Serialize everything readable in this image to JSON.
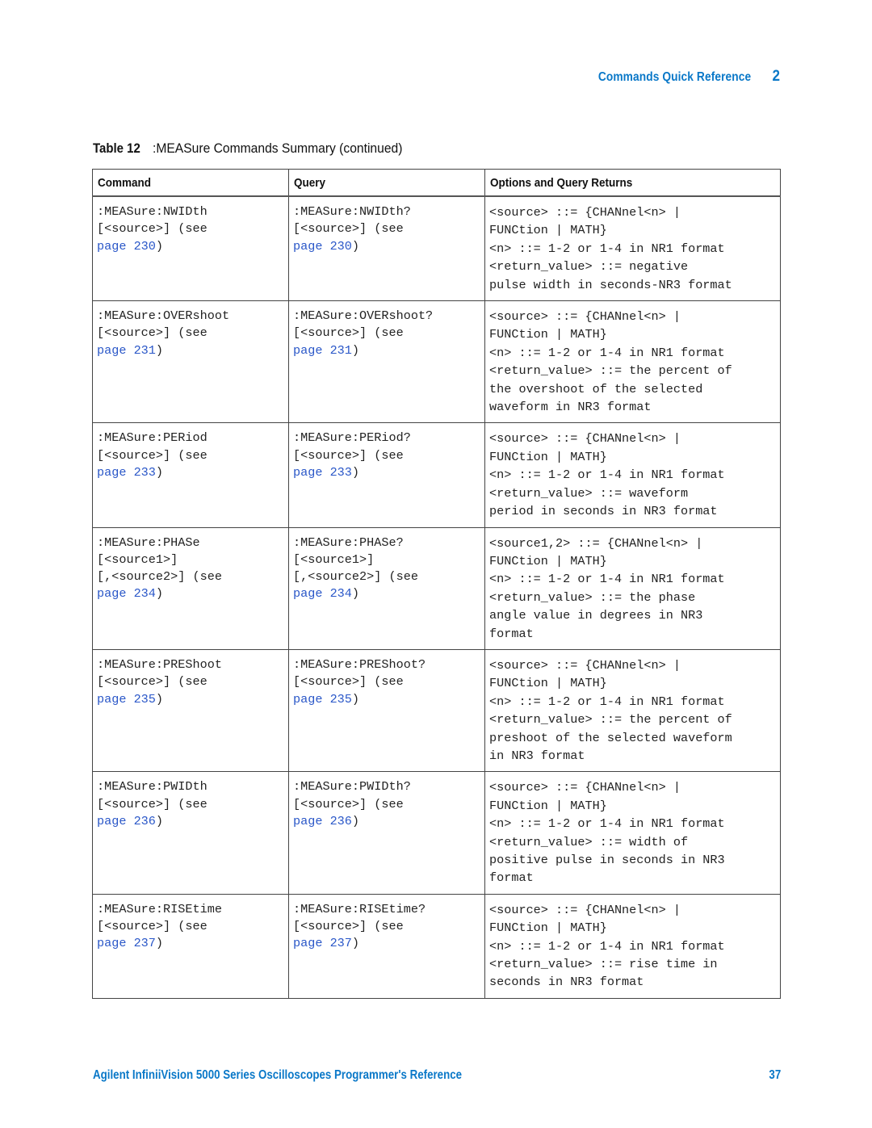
{
  "header": {
    "section_title": "Commands Quick Reference",
    "chapter_number": "2"
  },
  "table": {
    "label": "Table 12",
    "title": ":MEASure Commands Summary (continued)",
    "columns": [
      "Command",
      "Query",
      "Options and Query Returns"
    ],
    "rows": [
      {
        "command": [
          ":MEASure:NWIDth",
          "[<source>] (see"
        ],
        "command_link": "page 230",
        "query": [
          ":MEASure:NWIDth?",
          "[<source>] (see"
        ],
        "query_link": "page 230",
        "options": [
          "<source> ::= {CHANnel<n> |",
          "FUNCtion | MATH}",
          "<n> ::= 1-2 or 1-4 in NR1 format",
          "<return_value> ::= negative",
          "pulse width in seconds-NR3 format"
        ]
      },
      {
        "command": [
          ":MEASure:OVERshoot",
          "[<source>] (see"
        ],
        "command_link": "page 231",
        "query": [
          ":MEASure:OVERshoot?",
          "[<source>] (see"
        ],
        "query_link": "page 231",
        "options": [
          "<source> ::= {CHANnel<n> |",
          "FUNCtion | MATH}",
          "<n> ::= 1-2 or 1-4 in NR1 format",
          "<return_value> ::= the percent of",
          "the overshoot of the selected",
          "waveform in NR3 format"
        ]
      },
      {
        "command": [
          ":MEASure:PERiod",
          "[<source>] (see"
        ],
        "command_link": "page 233",
        "query": [
          ":MEASure:PERiod?",
          "[<source>] (see"
        ],
        "query_link": "page 233",
        "options": [
          "<source> ::= {CHANnel<n> |",
          "FUNCtion | MATH}",
          "<n> ::= 1-2 or 1-4 in NR1 format",
          "<return_value> ::= waveform",
          "period in seconds in NR3 format"
        ]
      },
      {
        "command": [
          ":MEASure:PHASe",
          "[<source1>]",
          "[,<source2>] (see"
        ],
        "command_link": "page 234",
        "query": [
          ":MEASure:PHASe?",
          "[<source1>]",
          "[,<source2>] (see"
        ],
        "query_link": "page 234",
        "options": [
          "<source1,2> ::= {CHANnel<n> |",
          "FUNCtion | MATH}",
          "<n> ::= 1-2 or 1-4 in NR1 format",
          "<return_value> ::= the phase",
          "angle value in degrees in NR3",
          "format"
        ]
      },
      {
        "command": [
          ":MEASure:PREShoot",
          "[<source>] (see"
        ],
        "command_link": "page 235",
        "query": [
          ":MEASure:PREShoot?",
          "[<source>] (see"
        ],
        "query_link": "page 235",
        "options": [
          "<source> ::= {CHANnel<n> |",
          "FUNCtion | MATH}",
          "<n> ::= 1-2 or 1-4 in NR1 format",
          "<return_value> ::= the percent of",
          "preshoot of the selected waveform",
          "in NR3 format"
        ]
      },
      {
        "command": [
          ":MEASure:PWIDth",
          "[<source>] (see"
        ],
        "command_link": "page 236",
        "query": [
          ":MEASure:PWIDth?",
          "[<source>] (see"
        ],
        "query_link": "page 236",
        "options": [
          "<source> ::= {CHANnel<n> |",
          "FUNCtion | MATH}",
          "<n> ::= 1-2 or 1-4 in NR1 format",
          "<return_value> ::= width of",
          "positive pulse in seconds in NR3",
          "format"
        ]
      },
      {
        "command": [
          ":MEASure:RISEtime",
          "[<source>] (see"
        ],
        "command_link": "page 237",
        "query": [
          ":MEASure:RISEtime?",
          "[<source>] (see"
        ],
        "query_link": "page 237",
        "options": [
          "<source> ::= {CHANnel<n> |",
          "FUNCtion | MATH}",
          "<n> ::= 1-2 or 1-4 in NR1 format",
          "<return_value> ::= rise time in",
          "seconds in NR3 format"
        ]
      }
    ]
  },
  "footer": {
    "book_title": "Agilent InfiniiVision 5000 Series Oscilloscopes Programmer's Reference",
    "page_number": "37"
  },
  "colors": {
    "accent": "#0a78c8",
    "link": "#2a57c8",
    "text": "#222222",
    "border": "#444444"
  }
}
